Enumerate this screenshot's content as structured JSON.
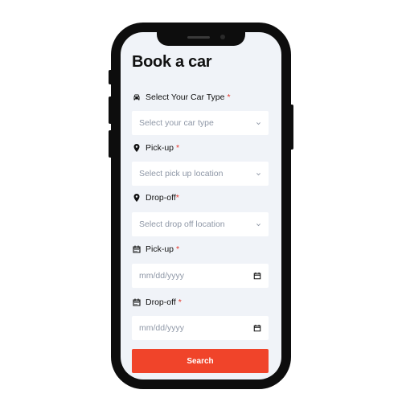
{
  "page": {
    "title": "Book a car"
  },
  "car_type": {
    "label": "Select Your Car Type",
    "required_mark": "*",
    "placeholder": "Select your car type"
  },
  "pickup_location": {
    "label": "Pick-up",
    "required_mark": "*",
    "placeholder": "Select pick up location"
  },
  "dropoff_location": {
    "label": "Drop-off",
    "required_mark": "*",
    "placeholder": "Select drop off location"
  },
  "pickup_date": {
    "label": "Pick-up",
    "required_mark": "*",
    "placeholder": "mm/dd/yyyy"
  },
  "dropoff_date": {
    "label": "Drop-off",
    "required_mark": "*",
    "placeholder": "mm/dd/yyyy"
  },
  "search_button": {
    "label": "Search"
  },
  "colors": {
    "accent": "#f0442a",
    "required": "#e4362b",
    "screen_background": "#f0f3f8"
  },
  "icons": {
    "car_type": "car-icon",
    "pickup_location": "map-pin-icon",
    "dropoff_location": "map-pin-icon",
    "pickup_date": "calendar-icon",
    "dropoff_date": "calendar-icon",
    "select": "chevron-down-icon",
    "date": "calendar-icon"
  }
}
